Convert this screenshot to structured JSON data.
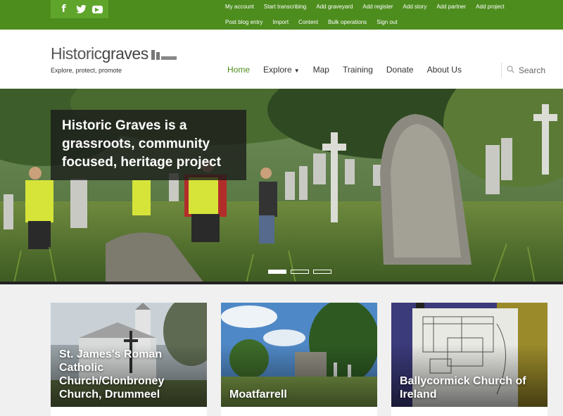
{
  "social": {
    "facebook": "f",
    "twitter": "t",
    "youtube": "▶"
  },
  "admin_links": {
    "row1": [
      "My account",
      "Start transcribing",
      "Add graveyard",
      "Add register",
      "Add story",
      "Add partner",
      "Add project"
    ],
    "row2": [
      "Post blog entry",
      "Import",
      "Content",
      "Bulk operations",
      "Sign out"
    ]
  },
  "logo": {
    "part1": "Historic",
    "part2": "graves"
  },
  "tagline": "Explore, protect, promote",
  "nav": {
    "home": "Home",
    "explore": "Explore",
    "map": "Map",
    "training": "Training",
    "donate": "Donate",
    "about": "About Us"
  },
  "search": {
    "label": "Search"
  },
  "hero": {
    "headline": "Historic Graves is a grassroots, community focused, heritage project"
  },
  "cards": [
    {
      "title": "St. James's Roman Catholic Church/Clonbroney Church, Drummeel"
    },
    {
      "title": "Moatfarrell"
    },
    {
      "title": "Ballycormick Church of Ireland"
    }
  ],
  "colors": {
    "brand_green": "#4d8d1e",
    "nav_active": "#4d8d1e"
  }
}
